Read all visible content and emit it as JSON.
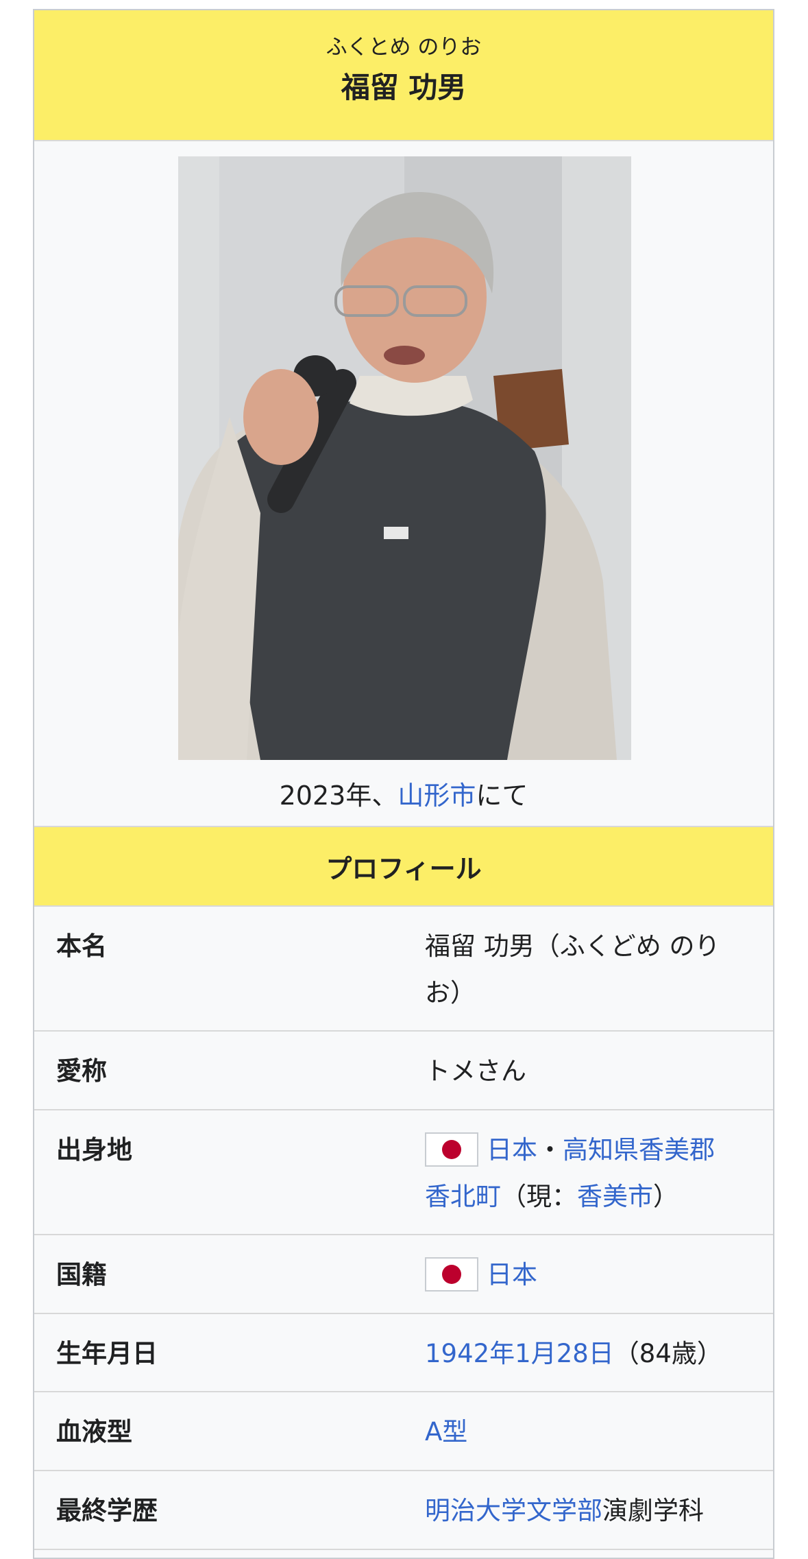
{
  "header": {
    "ruby": "ふくとめ のりお",
    "name": "福留 功男"
  },
  "photo": {
    "caption_prefix": "2023年、",
    "caption_link": "山形市",
    "caption_suffix": "にて"
  },
  "section_title": "プロフィール",
  "rows": {
    "real_name": {
      "label": "本名",
      "value": "福留 功男（ふくどめ のりお）"
    },
    "nickname": {
      "label": "愛称",
      "value": "トメさん"
    },
    "birthplace": {
      "label": "出身地",
      "flag_icon": "japan-flag-icon",
      "country": "日本",
      "sep": "・",
      "prefecture_district": "高知県香美郡",
      "town": "香北町",
      "current_open": "（現：",
      "current_city": "香美市",
      "current_close": "）"
    },
    "nationality": {
      "label": "国籍",
      "flag_icon": "japan-flag-icon",
      "country": "日本"
    },
    "birthdate": {
      "label": "生年月日",
      "date": "1942年1月28日",
      "age": "（84歳）"
    },
    "blood_type": {
      "label": "血液型",
      "value": "A型"
    },
    "education": {
      "label": "最終学歴",
      "school": "明治大学文学部",
      "department": "演劇学科"
    }
  },
  "colors": {
    "header_bg": "#fcee67",
    "link": "#3366cc",
    "japan_red": "#bc002d"
  }
}
